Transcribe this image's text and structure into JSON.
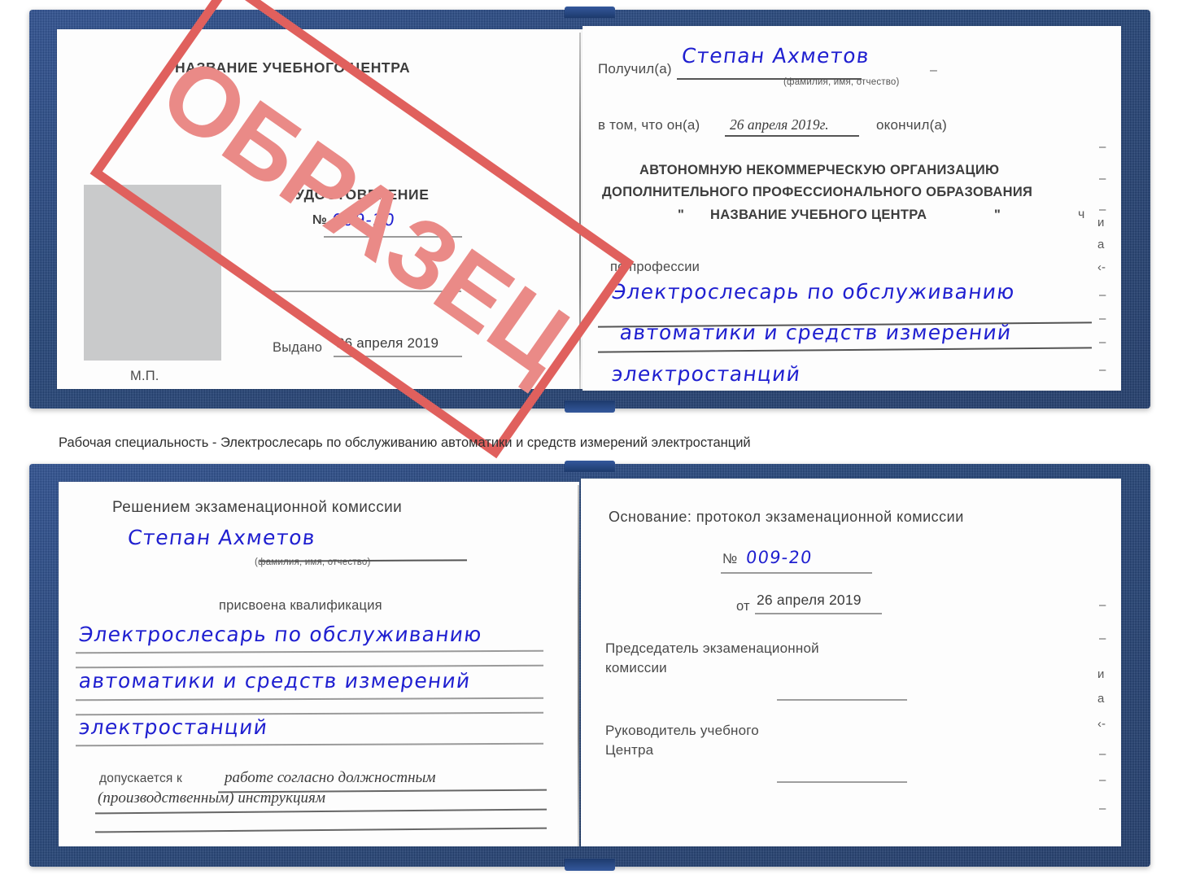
{
  "document": {
    "type": "Удостоверение",
    "watermark": "ОБРАЗЕЦ",
    "ink_color": "#1f1fd0",
    "cover_color": "#204279",
    "stamp_color": "#e0605d"
  },
  "caption": {
    "text": "Рабочая специальность - Электрослесарь по обслуживанию автоматики и средств измерений электростанций"
  },
  "cert_top": {
    "left_page": {
      "org_title": "НАЗВАНИЕ УЧЕБНОГО ЦЕНТРА",
      "doc_type": "УДОСТОВЕРЕНИЕ",
      "number_label": "№",
      "number_value": "009-20",
      "issued_label": "Выдано",
      "issued_date": "26 апреля 2019",
      "seal_label": "М.П.",
      "photo_placeholder": "photo-area"
    },
    "right_page": {
      "received_label": "Получил(а)",
      "received_name": "Степан Ахметов",
      "name_hint": "(фамилия, имя, отчество)",
      "in_that_label": "в том, что он(а)",
      "completion_date": "26 апреля 2019г.",
      "finished_label": "окончил(а)",
      "org_line1": "АВТОНОМНУЮ НЕКОММЕРЧЕСКУЮ ОРГАНИЗАЦИЮ",
      "org_line2": "ДОПОЛНИТЕЛЬНОГО ПРОФЕССИОНАЛЬНОГО ОБРАЗОВАНИЯ",
      "org_quote_open": "\"",
      "org_line3": "НАЗВАНИЕ УЧЕБНОГО ЦЕНТРА",
      "org_quote_close": "\"",
      "profession_label": "по профессии",
      "profession_line1": "Электрослесарь по обслуживанию",
      "profession_line2": "автоматики и средств измерений",
      "profession_line3": "электростанций"
    }
  },
  "cert_bottom": {
    "left_page": {
      "decision_title": "Решением экзаменационной комиссии",
      "person_name": "Степан Ахметов",
      "name_hint": "(фамилия, имя, отчество)",
      "qualification_label": "присвоена квалификация",
      "qualification_line1": "Электрослесарь по обслуживанию",
      "qualification_line2": "автоматики и средств измерений",
      "qualification_line3": "электростанций",
      "allowed_label": "допускается к",
      "allowed_value_line1": "работе согласно должностным",
      "allowed_value_line2": "(производственным) инструкциям"
    },
    "right_page": {
      "basis_label": "Основание: протокол экзаменационной комиссии",
      "protocol_number_label": "№",
      "protocol_number_value": "009-20",
      "protocol_date_label": "от",
      "protocol_date_value": "26 апреля 2019",
      "chairman_line1": "Председатель экзаменационной",
      "chairman_line2": "комиссии",
      "head_line1": "Руководитель учебного",
      "head_line2": "Центра"
    }
  },
  "edge_fragments": {
    "top": [
      "–",
      "–",
      "–",
      "и",
      "а",
      "‹-",
      "–",
      "–",
      "–",
      "–"
    ],
    "bottom": [
      "–",
      "–",
      "и",
      "а",
      "‹-",
      "–",
      "–",
      "–"
    ]
  }
}
